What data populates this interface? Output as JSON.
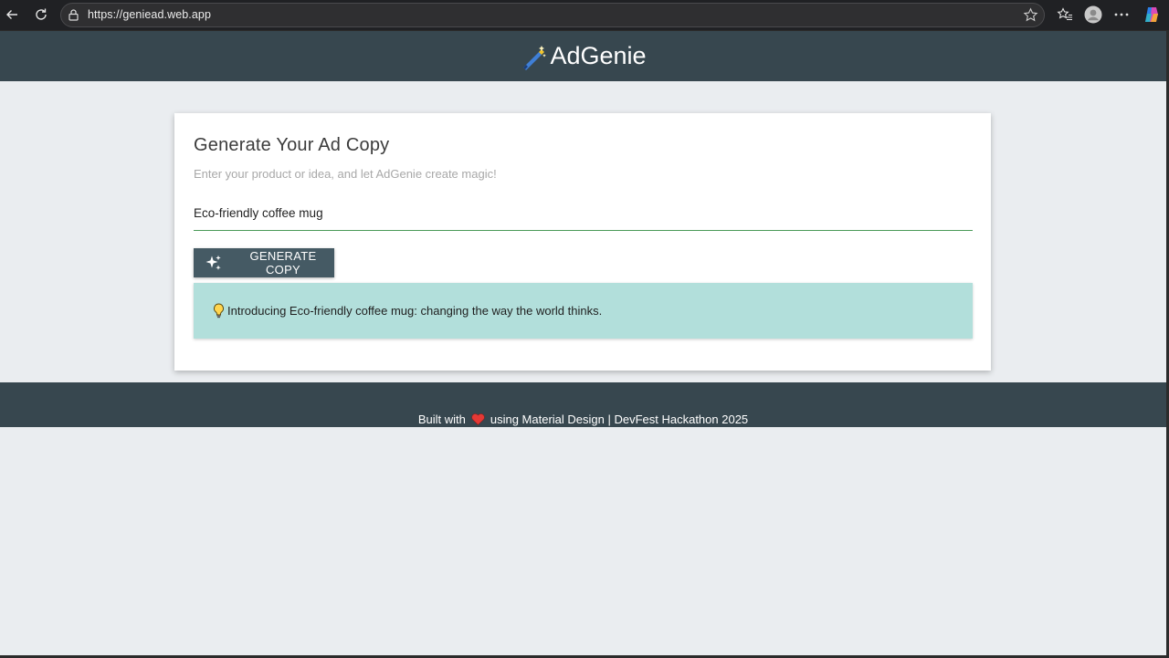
{
  "browser": {
    "url": "https://geniead.web.app"
  },
  "header": {
    "brand": "AdGenie",
    "brand_icon": "magic-wand-icon"
  },
  "card": {
    "title": "Generate Your Ad Copy",
    "subtitle": "Enter your product or idea, and let AdGenie create magic!",
    "input_value": "Eco-friendly coffee mug",
    "button_label": "GENERATE COPY",
    "button_icon": "sparkle-icon",
    "result_icon": "lightbulb-icon",
    "result_text": "Introducing Eco-friendly coffee mug: changing the way the world thinks."
  },
  "footer": {
    "prefix": "Built with",
    "heart_icon": "heart-icon",
    "suffix": "using Material Design | DevFest Hackathon 2025"
  },
  "colors": {
    "header_bg": "#37474f",
    "page_bg": "#eaedf0",
    "button_bg": "#455a64",
    "result_bg": "#b2dfdb",
    "input_underline": "#4a9a58",
    "heart": "#e53935"
  }
}
